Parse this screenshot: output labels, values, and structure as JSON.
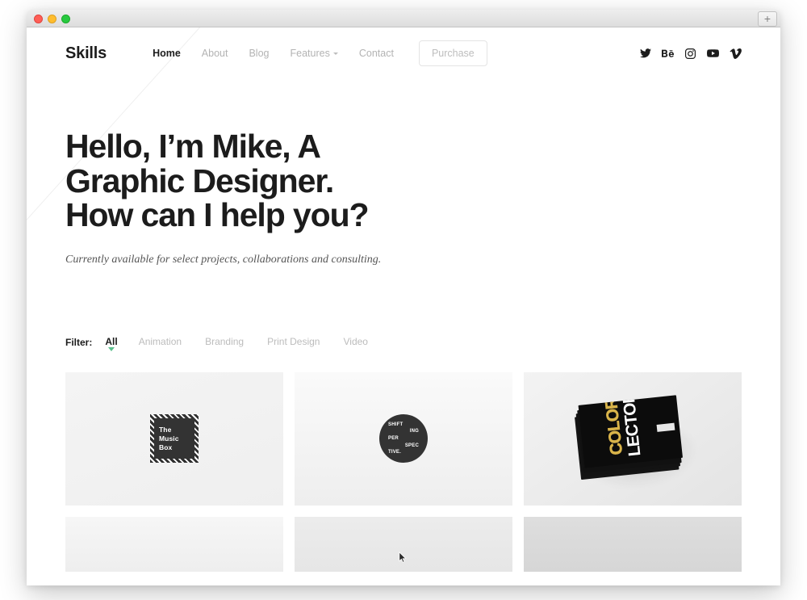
{
  "browser": {
    "traffic_lights": [
      "close",
      "minimize",
      "maximize"
    ],
    "new_tab_label": "+"
  },
  "header": {
    "logo": "Skills",
    "nav": [
      {
        "label": "Home",
        "active": true,
        "has_caret": false
      },
      {
        "label": "About",
        "active": false,
        "has_caret": false
      },
      {
        "label": "Blog",
        "active": false,
        "has_caret": false
      },
      {
        "label": "Features",
        "active": false,
        "has_caret": true
      },
      {
        "label": "Contact",
        "active": false,
        "has_caret": false
      }
    ],
    "purchase_label": "Purchase",
    "social": [
      {
        "name": "twitter"
      },
      {
        "name": "behance"
      },
      {
        "name": "instagram"
      },
      {
        "name": "youtube"
      },
      {
        "name": "vimeo"
      }
    ]
  },
  "hero": {
    "title_line1": "Hello, I’m Mike, A",
    "title_line2": "Graphic Designer.",
    "title_line3": "How can I help you?",
    "subtitle": "Currently available for select projects, collaborations and consulting."
  },
  "filter": {
    "label": "Filter:",
    "items": [
      {
        "label": "All",
        "active": true
      },
      {
        "label": "Animation",
        "active": false
      },
      {
        "label": "Branding",
        "active": false
      },
      {
        "label": "Print Design",
        "active": false
      },
      {
        "label": "Video",
        "active": false
      }
    ],
    "active_caret_color": "#5bbf8d"
  },
  "portfolio": {
    "tiles": [
      {
        "id": "music-box",
        "artwork": "dark square with diagonal striped border",
        "lines": [
          "The",
          "Music",
          "Box"
        ]
      },
      {
        "id": "shifting-perspective",
        "artwork": "dark circular badge",
        "lines": [
          "SHIFT",
          "ING",
          "PER",
          "SPEC",
          "TIVE."
        ]
      },
      {
        "id": "colors-lector",
        "artwork": "stack of black books photographed on white",
        "word_gold": "COLORS",
        "word_white": "LECTOR"
      },
      {
        "id": "tile-4",
        "artwork": "light gray placeholder"
      },
      {
        "id": "tile-5",
        "artwork": "light gray placeholder"
      },
      {
        "id": "tile-6",
        "artwork": "medium gray placeholder"
      }
    ]
  },
  "colors": {
    "text_dark": "#1c1c1c",
    "text_muted": "#b3b3b3",
    "accent_green": "#5bbf8d",
    "page_bg": "#ffffff",
    "tile_bg": "#f1f1f1",
    "book_gold": "#d9b44a"
  }
}
